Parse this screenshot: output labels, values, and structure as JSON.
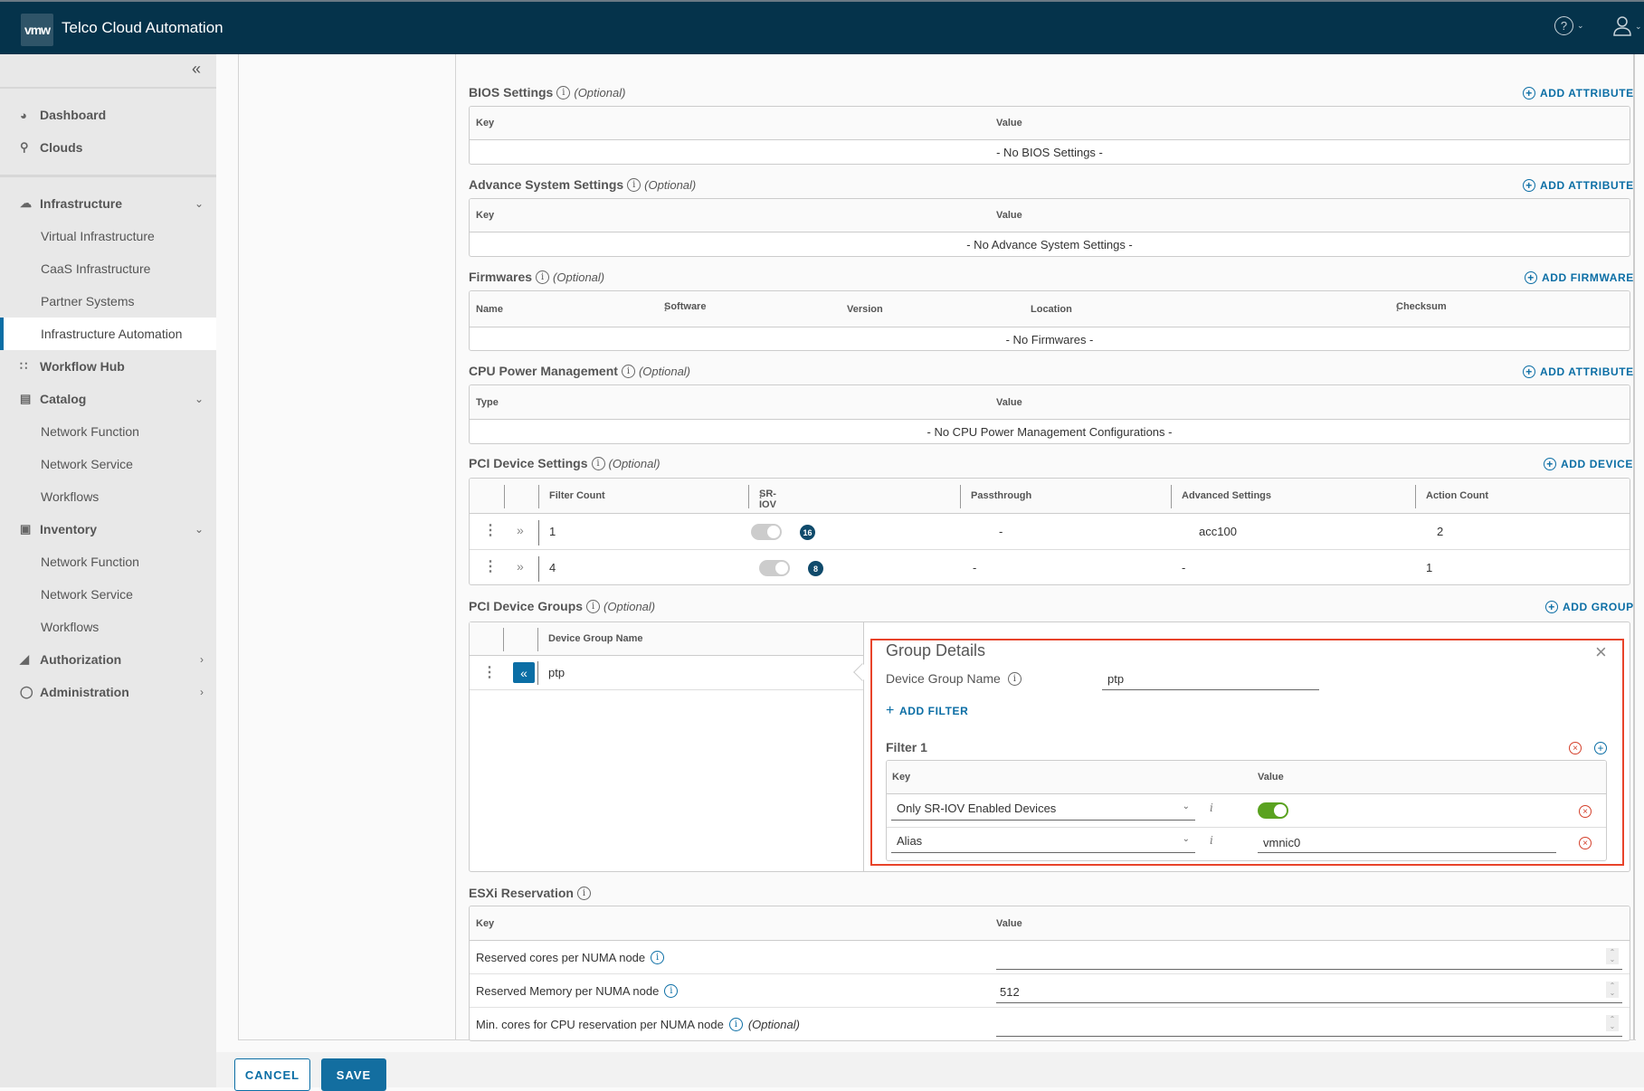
{
  "header": {
    "logo": "vmw",
    "title": "Telco Cloud Automation",
    "help_icon": "help-icon",
    "user_icon": "user-icon"
  },
  "sidebar": {
    "collapse_icon": "double-chevron-left-icon",
    "items": [
      {
        "label": "Dashboard",
        "icon": "dashboard-icon",
        "level": 0
      },
      {
        "label": "Clouds",
        "icon": "location-pin-icon",
        "level": 0
      },
      {
        "label": "Infrastructure",
        "icon": "cloud-icon",
        "level": 0,
        "expanded": true
      },
      {
        "label": "Virtual Infrastructure",
        "level": 1
      },
      {
        "label": "CaaS Infrastructure",
        "level": 1
      },
      {
        "label": "Partner Systems",
        "level": 1
      },
      {
        "label": "Infrastructure Automation",
        "level": 1,
        "active": true
      },
      {
        "label": "Workflow Hub",
        "icon": "workflow-icon",
        "level": 0
      },
      {
        "label": "Catalog",
        "icon": "catalog-icon",
        "level": 0,
        "expanded": true
      },
      {
        "label": "Network Function",
        "level": 1
      },
      {
        "label": "Network Service",
        "level": 1
      },
      {
        "label": "Workflows",
        "level": 1
      },
      {
        "label": "Inventory",
        "icon": "inventory-icon",
        "level": 0,
        "expanded": true
      },
      {
        "label": "Network Function",
        "level": 1
      },
      {
        "label": "Network Service",
        "level": 1
      },
      {
        "label": "Workflows",
        "level": 1
      },
      {
        "label": "Authorization",
        "icon": "lock-icon",
        "level": 0,
        "expanded": false
      },
      {
        "label": "Administration",
        "icon": "user-icon",
        "level": 0,
        "expanded": false
      }
    ]
  },
  "optional_label": "(Optional)",
  "bios": {
    "title": "BIOS Settings",
    "add": "ADD ATTRIBUTE",
    "columns": [
      "Key",
      "Value"
    ],
    "empty": "- No BIOS Settings -"
  },
  "advance": {
    "title": "Advance System Settings",
    "add": "ADD ATTRIBUTE",
    "columns": [
      "Key",
      "Value"
    ],
    "empty": "- No Advance System Settings -"
  },
  "firmwares": {
    "title": "Firmwares",
    "add": "ADD FIRMWARE",
    "columns": [
      "Name",
      "Software",
      "Version",
      "Location",
      "Checksum"
    ],
    "empty": "- No Firmwares -"
  },
  "cpu": {
    "title": "CPU Power Management",
    "add": "ADD ATTRIBUTE",
    "columns": [
      "Type",
      "Value"
    ],
    "empty": "- No CPU Power Management Configurations -"
  },
  "pci_settings": {
    "title": "PCI Device Settings",
    "add": "ADD DEVICE",
    "columns": [
      "Filter Count",
      "SR-IOV",
      "Passthrough",
      "Advanced Settings",
      "Action Count"
    ],
    "rows": [
      {
        "filter_count": "1",
        "sriov_enabled": false,
        "sriov_count": "16",
        "passthrough": "-",
        "advanced": "acc100",
        "action_count": "2"
      },
      {
        "filter_count": "4",
        "sriov_enabled": false,
        "sriov_count": "8",
        "passthrough": "-",
        "advanced": "-",
        "action_count": "1"
      }
    ]
  },
  "pci_groups": {
    "title": "PCI Device Groups",
    "add": "ADD GROUP",
    "columns": [
      "Device Group Name"
    ],
    "rows": [
      {
        "name": "ptp"
      }
    ]
  },
  "group_details": {
    "title": "Group Details",
    "name_label": "Device Group Name",
    "name_value": "ptp",
    "add_filter": "ADD FILTER",
    "filter_title": "Filter 1",
    "columns": [
      "Key",
      "Value"
    ],
    "rows": [
      {
        "key": "Only SR-IOV Enabled Devices",
        "value_type": "toggle",
        "value": true
      },
      {
        "key": "Alias",
        "value_type": "text",
        "value": "vmnic0"
      }
    ]
  },
  "esxi": {
    "title": "ESXi Reservation",
    "columns": [
      "Key",
      "Value"
    ],
    "rows": [
      {
        "key": "Reserved cores per NUMA node",
        "value": "",
        "optional": false
      },
      {
        "key": "Reserved Memory per NUMA node",
        "value": "512",
        "optional": false
      },
      {
        "key": "Min. cores for CPU reservation per NUMA node",
        "value": "",
        "optional": true
      }
    ]
  },
  "footer": {
    "cancel": "CANCEL",
    "save": "SAVE"
  }
}
